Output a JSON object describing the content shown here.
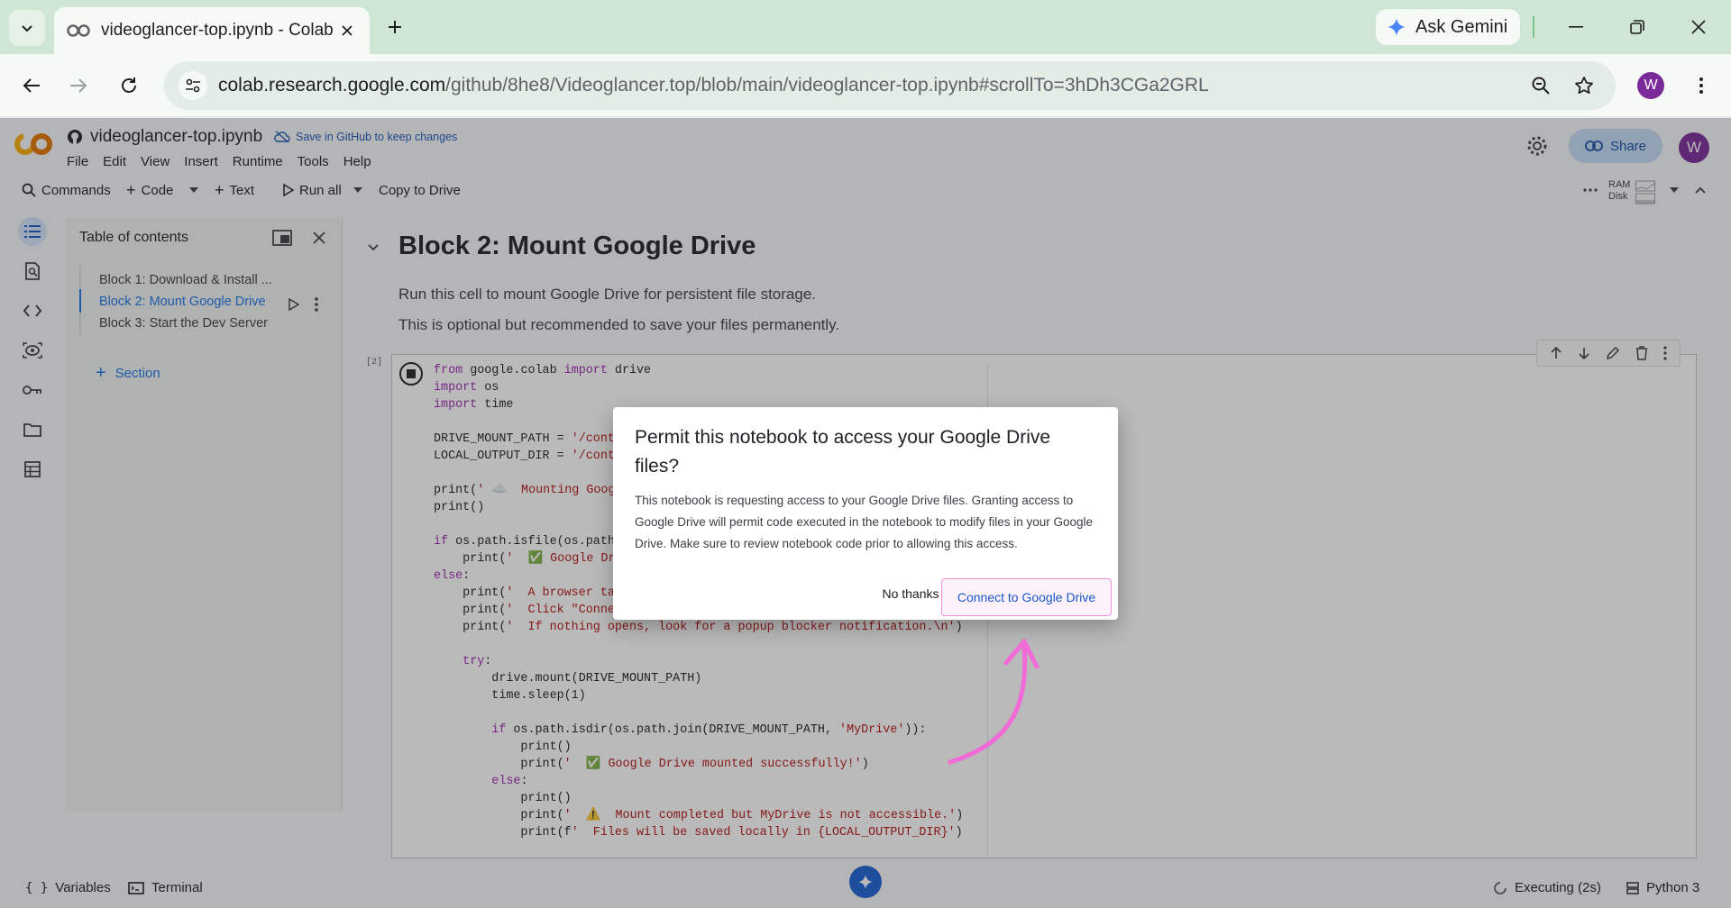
{
  "browser": {
    "tab_title": "videoglancer-top.ipynb - Colab",
    "ask_gemini": "Ask Gemini",
    "url_host": "colab.research.google.com",
    "url_path": "/github/8he8/Videoglancer.top/blob/main/videoglancer-top.ipynb#scrollTo=3hDh3CGa2GRL",
    "profile_initial": "W"
  },
  "colab": {
    "notebook_name": "videoglancer-top.ipynb",
    "save_notice": "Save in GitHub to keep changes",
    "menu": [
      "File",
      "Edit",
      "View",
      "Insert",
      "Runtime",
      "Tools",
      "Help"
    ],
    "share_label": "Share",
    "avatar_initial": "W",
    "toolbar": {
      "commands": "Commands",
      "code": "Code",
      "text": "Text",
      "run_all": "Run all",
      "copy_to_drive": "Copy to Drive",
      "ram": "RAM",
      "disk": "Disk"
    },
    "toc": {
      "title": "Table of contents",
      "items": [
        "Block 1: Download & Install ...",
        "Block 2: Mount Google Drive",
        "Block 3: Start the Dev Server"
      ],
      "active_index": 1,
      "add_section": "Section"
    },
    "section": {
      "title": "Block 2: Mount Google Drive",
      "text1": "Run this cell to mount Google Drive for persistent file storage.",
      "text2": "This is optional but recommended to save your files permanently.",
      "exec_count": "[2]"
    },
    "code_lines": [
      "from google.colab import drive",
      "import os",
      "import time",
      "",
      "DRIVE_MOUNT_PATH = '/conte",
      "LOCAL_OUTPUT_DIR = '/conte",
      "",
      "print(' ☁️  Mounting Googl",
      "print()",
      "",
      "if os.path.isfile(os.path.",
      "    print('  ✅ Google Dri",
      "else:",
      "    print('  A browser tab",
      "    print('  Click \"Connec",
      "    print('  If nothing opens, look for a popup blocker notification.\\n')",
      "",
      "    try:",
      "        drive.mount(DRIVE_MOUNT_PATH)",
      "        time.sleep(1)",
      "",
      "        if os.path.isdir(os.path.join(DRIVE_MOUNT_PATH, 'MyDrive')):",
      "            print()",
      "            print('  ✅ Google Drive mounted successfully!')",
      "        else:",
      "            print()",
      "            print('  ⚠️  Mount completed but MyDrive is not accessible.')",
      "            print(f'  Files will be saved locally in {LOCAL_OUTPUT_DIR}')"
    ],
    "status": {
      "variables": "Variables",
      "terminal": "Terminal",
      "executing": "Executing (2s)",
      "runtime": "Python 3"
    }
  },
  "dialog": {
    "title": "Permit this notebook to access your Google Drive files?",
    "body": "This notebook is requesting access to your Google Drive files. Granting access to Google Drive will permit code executed in the notebook to modify files in your Google Drive. Make sure to review notebook code prior to allowing this access.",
    "decline": "No thanks",
    "accept": "Connect to Google Drive"
  },
  "colors": {
    "accent": "#1a73e8",
    "highlight_arrow": "#f06ad8"
  }
}
